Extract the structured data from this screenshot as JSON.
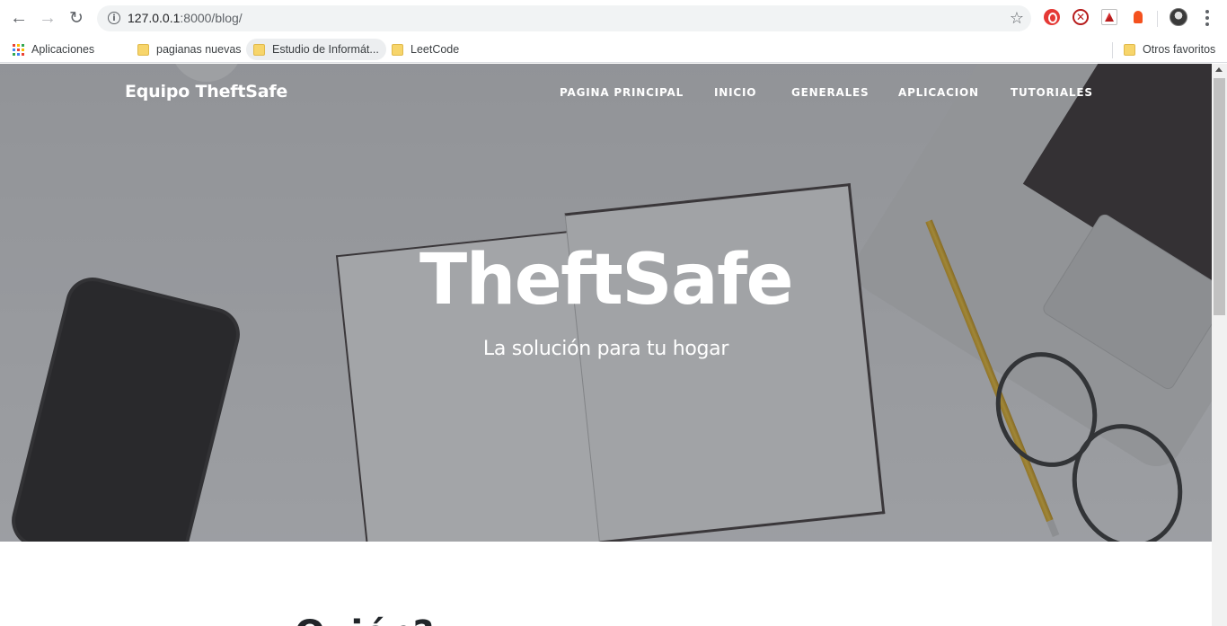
{
  "browser": {
    "address": {
      "host": "127.0.0.1",
      "path": ":8000/blog/"
    },
    "bookmarks": [
      {
        "label": "Aplicaciones",
        "icon": "apps-icon"
      },
      {
        "label": "pagianas nuevas",
        "icon": "folder-icon"
      },
      {
        "label": "Estudio de Informát...",
        "icon": "folder-icon"
      },
      {
        "label": "LeetCode",
        "icon": "folder-icon"
      },
      {
        "label": "Otros favoritos",
        "icon": "folder-icon"
      }
    ]
  },
  "site": {
    "brand": "Equipo TheftSafe",
    "nav": [
      "PAGINA PRINCIPAL",
      "INICIO",
      "GENERALES",
      "APLICACION",
      "TUTORIALES"
    ],
    "hero": {
      "title": "TheftSafe",
      "subtitle": "La solución para tu hogar"
    },
    "section_heading_partial": "Quién?"
  }
}
